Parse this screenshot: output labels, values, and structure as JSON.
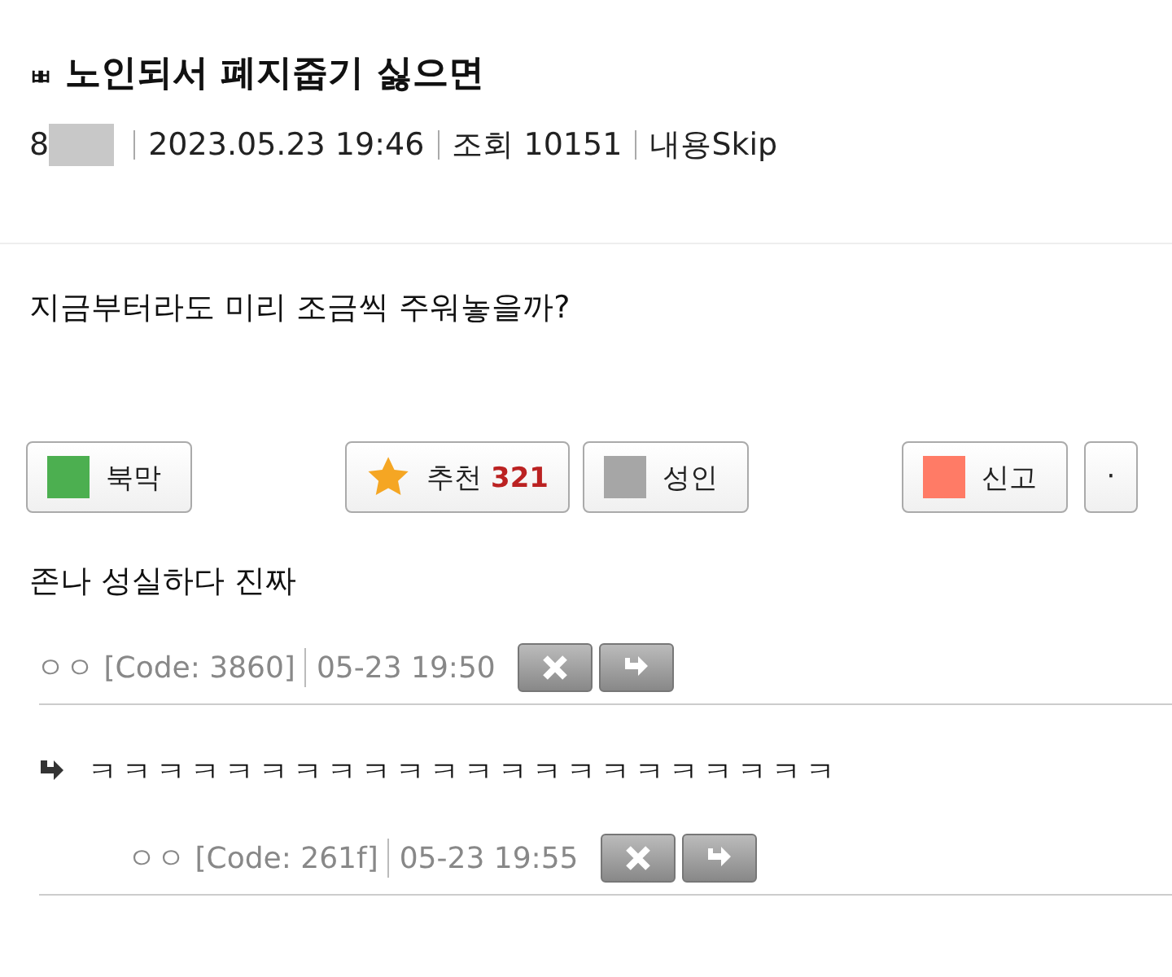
{
  "post": {
    "category": "ㅃ",
    "title": "노인되서 폐지줍기 싫으면",
    "author": "8",
    "date": "2023.05.23 19:46",
    "views_label": "조회",
    "views": "10151",
    "skip": "내용Skip",
    "body": "지금부터라도 미리 조금씩 주워놓을까?"
  },
  "buttons": [
    {
      "kind": "square",
      "label": "북막",
      "color": "#4caf50"
    },
    {
      "kind": "star",
      "label": "추천",
      "count": "321"
    },
    {
      "kind": "square",
      "label": "성인",
      "color": "#a6a6a6"
    },
    {
      "kind": "square",
      "label": "신고",
      "color": "#ff7b66"
    },
    {
      "kind": "dot",
      "label": "·"
    }
  ],
  "comments": [
    {
      "text": "존나 성실하다 진짜",
      "nick": "ㅇㅇ",
      "code": "[Code: 3860]",
      "time": "05-23 19:50",
      "children": [
        {
          "text": "ㅋㅋㅋㅋㅋㅋㅋㅋㅋㅋㅋㅋㅋㅋㅋㅋㅋㅋㅋㅋㅋㅋ",
          "nick": "ㅇㅇ",
          "code": "[Code: 261f]",
          "time": "05-23 19:55"
        }
      ]
    }
  ]
}
